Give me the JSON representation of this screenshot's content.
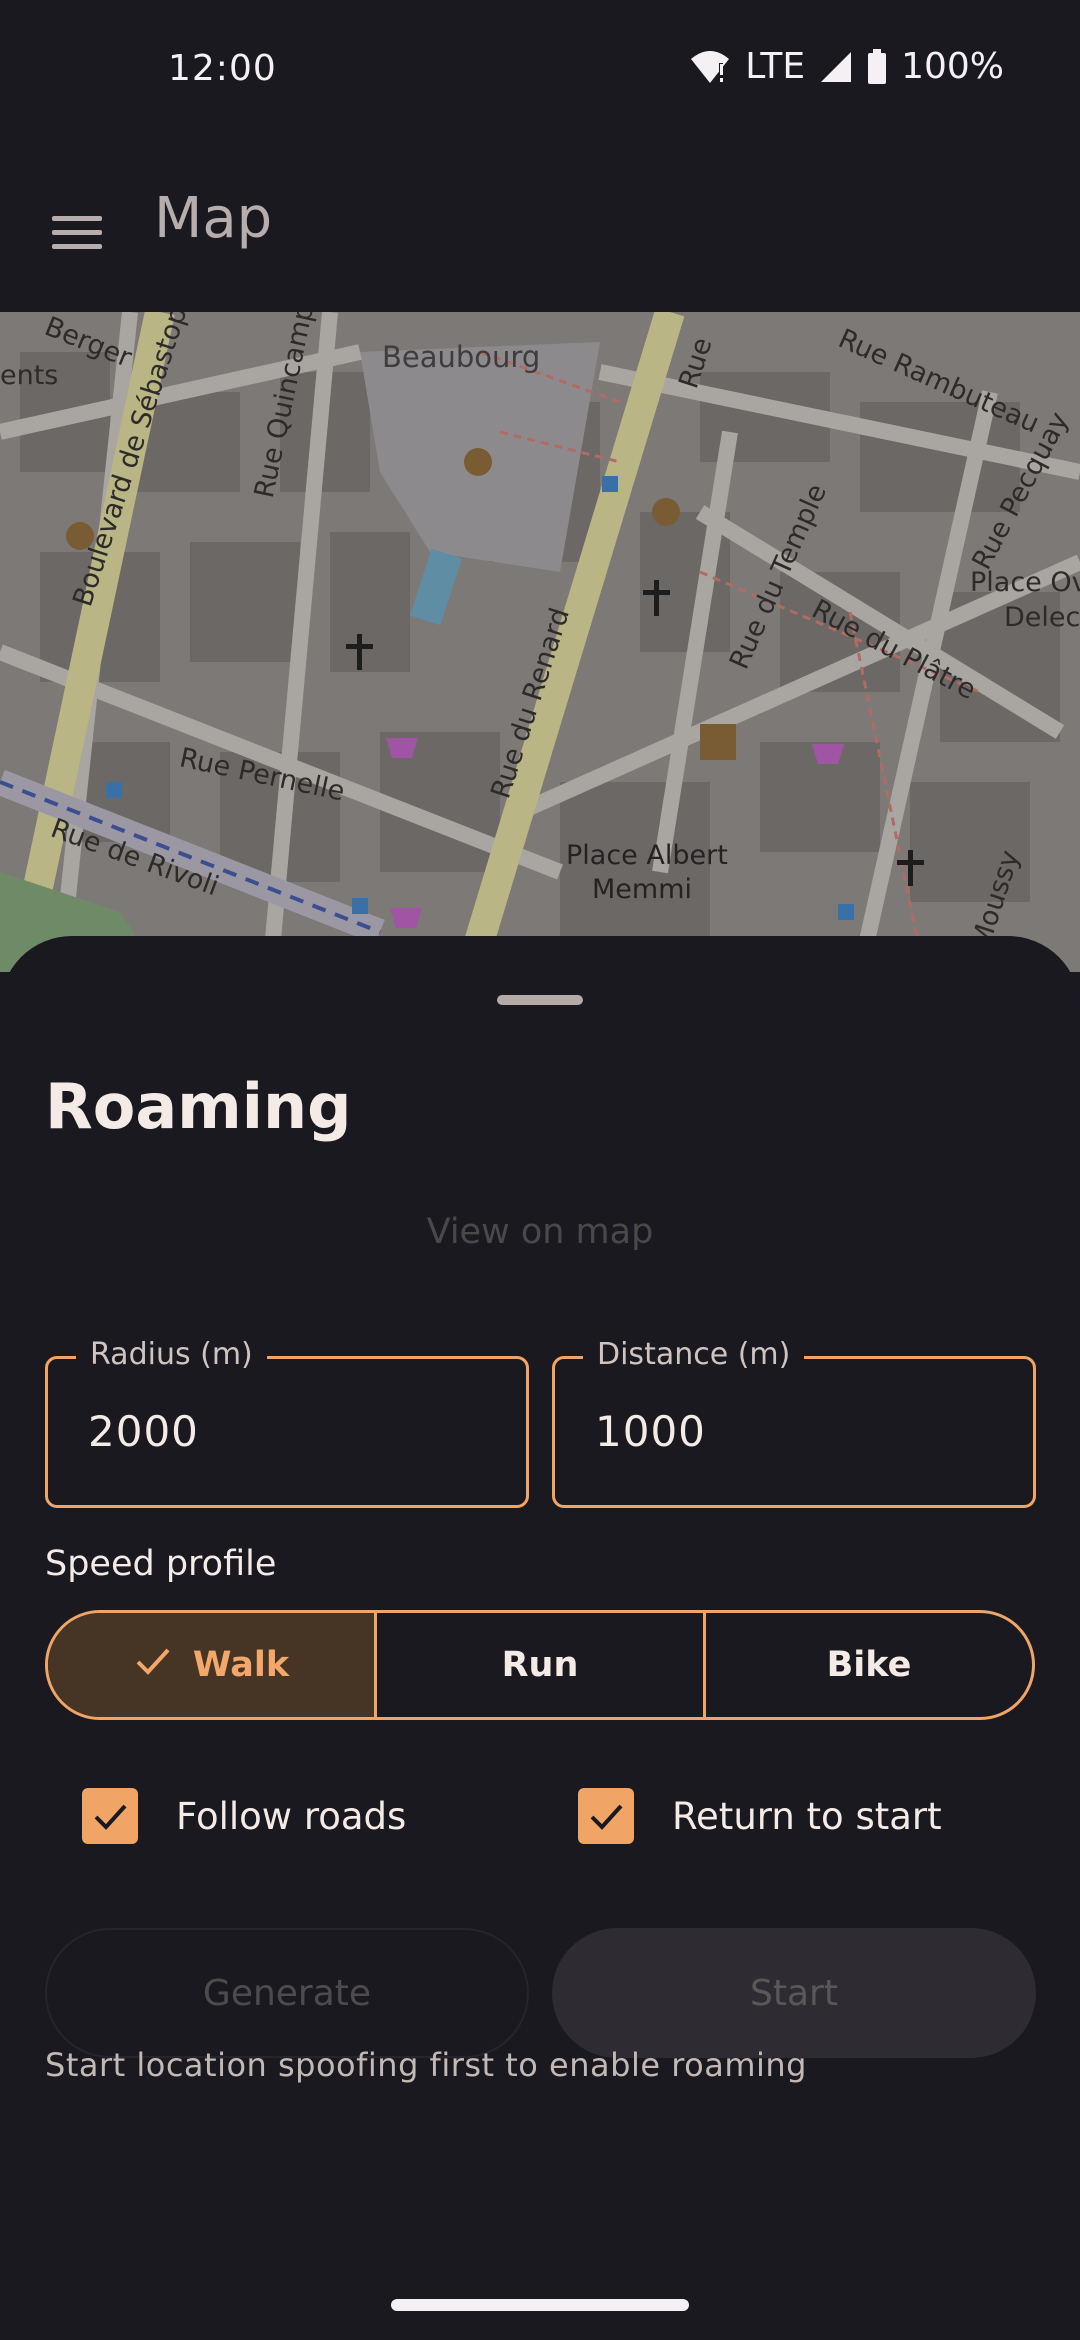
{
  "status": {
    "time": "12:00",
    "network": "LTE",
    "battery": "100%"
  },
  "app_bar": {
    "title": "Map",
    "menu_icon": "menu-icon"
  },
  "map": {
    "labels": {
      "beaubourg": "Beaubourg",
      "sebastopol": "Boulevard de Sébastopol",
      "quincampoix": "Rue Quincampoix",
      "saint_martin": "Rue Saint-Martin",
      "renard": "Rue du Renard",
      "temple": "Rue du Temple",
      "platre": "Rue du Plâtre",
      "rambuteau": "Rue Rambuteau",
      "pecquay": "Rue Pecquay",
      "place_ov": "Place Ov",
      "delec": "Delec",
      "pernelle": "Rue Pernelle",
      "rivoli": "Rue de Rivoli",
      "albert_1": "Place Albert",
      "albert_2": "Memmi",
      "moussy": "Moussy",
      "berger": "Berger",
      "ents": "ents",
      "rue_top": "Rue"
    }
  },
  "sheet": {
    "title": "Roaming",
    "view_on_map": "View on map",
    "radius": {
      "label": "Radius (m)",
      "value": "2000"
    },
    "distance": {
      "label": "Distance (m)",
      "value": "1000"
    },
    "speed_profile": {
      "label": "Speed profile",
      "options": [
        "Walk",
        "Run",
        "Bike"
      ],
      "selected": "Walk"
    },
    "follow_roads": {
      "label": "Follow roads",
      "checked": true
    },
    "return_to_start": {
      "label": "Return to start",
      "checked": true
    },
    "generate_label": "Generate",
    "start_label": "Start",
    "hint": "Start location spoofing first to enable roaming"
  },
  "colors": {
    "accent": "#f0a567",
    "background": "#1a1920",
    "selected_segment": "#463525"
  }
}
